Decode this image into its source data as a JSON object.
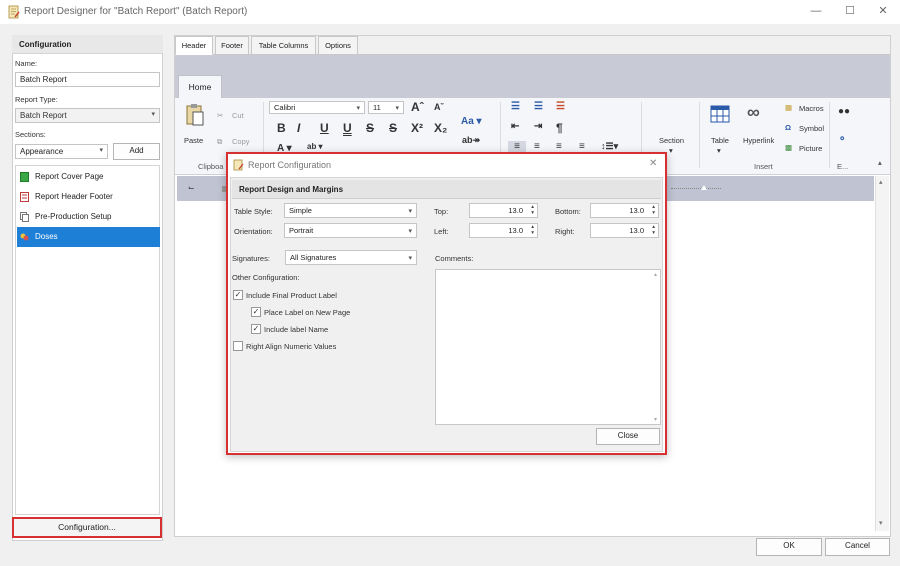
{
  "window": {
    "title": "Report Designer for \"Batch Report\" (Batch Report)"
  },
  "left": {
    "header": "Configuration",
    "name_label": "Name:",
    "name_value": "Batch Report",
    "type_label": "Report Type:",
    "type_value": "Batch Report",
    "sections_label": "Sections:",
    "sections_select": "Appearance",
    "add_label": "Add",
    "items": [
      {
        "label": "Report Cover Page",
        "icon": "green-book-icon"
      },
      {
        "label": "Report Header Footer",
        "icon": "red-page-icon"
      },
      {
        "label": "Pre-Production Setup",
        "icon": "document-copy-icon"
      },
      {
        "label": "Doses",
        "icon": "pills-icon"
      }
    ],
    "config_button": "Configuration..."
  },
  "tabs": [
    "Header",
    "Footer",
    "Table Columns",
    "Options"
  ],
  "ribbon": {
    "home_tab": "Home",
    "paste": "Paste",
    "cut": "Cut",
    "copy": "Copy",
    "clipboard_group": "Clipboa",
    "font_name": "Calibri",
    "font_size": "11",
    "section": "Section",
    "table": "Table",
    "hyperlink": "Hyperlink",
    "macros": "Macros",
    "symbol": "Symbol",
    "picture": "Picture",
    "insert_group": "Insert",
    "edit_group": "E..."
  },
  "footer": {
    "ok": "OK",
    "cancel": "Cancel"
  },
  "dialog": {
    "title": "Report Configuration",
    "group": "Report Design and Margins",
    "table_style_label": "Table Style:",
    "table_style": "Simple",
    "orientation_label": "Orientation:",
    "orientation": "Portrait",
    "top_label": "Top:",
    "top": "13.0",
    "bottom_label": "Bottom:",
    "bottom": "13.0",
    "left_label": "Left:",
    "left": "13.0",
    "right_label": "Right:",
    "right": "13.0",
    "signatures_label": "Signatures:",
    "signatures": "All Signatures",
    "comments_label": "Comments:",
    "other_label": "Other Configuration:",
    "checks": [
      {
        "label": "Include Final Product Label",
        "checked": true
      },
      {
        "label": "Place Label on New Page",
        "checked": true
      },
      {
        "label": "Include label Name",
        "checked": true
      },
      {
        "label": "Right Align Numeric Values",
        "checked": false
      }
    ],
    "close": "Close"
  },
  "colors": {
    "selection": "#1e7fd6",
    "highlight": "#d63030",
    "ribbon": "#c8cad6"
  }
}
